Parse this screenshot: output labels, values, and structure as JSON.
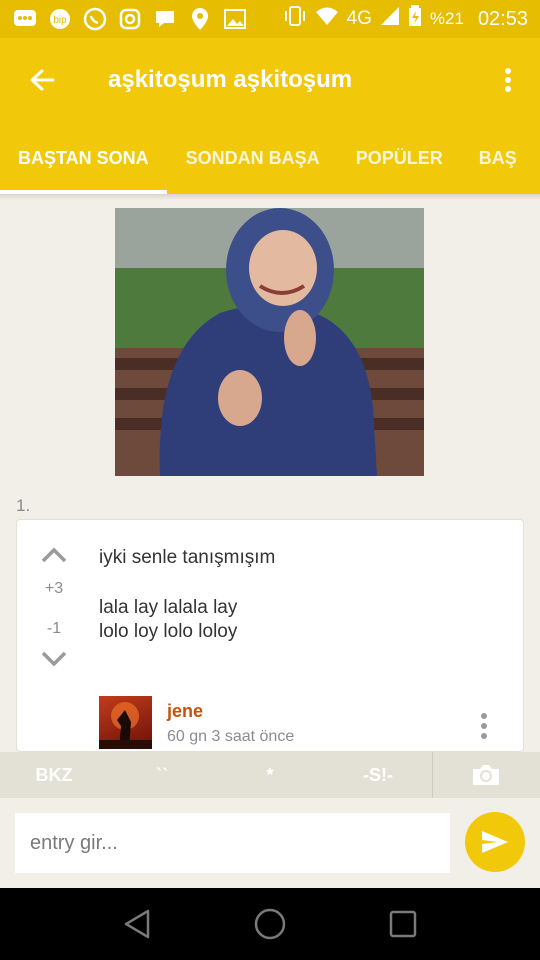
{
  "status_bar": {
    "network": "4G",
    "battery": "%21",
    "time": "02:53",
    "icons": [
      "message-icon",
      "bip-icon",
      "whatsapp-icon",
      "instagram-icon",
      "chat-icon",
      "location-icon",
      "image-icon"
    ]
  },
  "app_bar": {
    "title": "aşkitoşum aşkitoşum"
  },
  "tabs": [
    {
      "label": "BAŞTAN SONA",
      "active": true
    },
    {
      "label": "SONDAN BAŞA",
      "active": false
    },
    {
      "label": "POPÜLER",
      "active": false
    },
    {
      "label": "BAŞ",
      "active": false
    }
  ],
  "entry": {
    "index": "1.",
    "upvotes": "+3",
    "downvotes": "-1",
    "lines": [
      "iyki senle tanışmışım",
      "lala lay lalala lay",
      "lolo loy lolo loloy"
    ],
    "author": "jene",
    "meta": "60 gn 3 saat  önce"
  },
  "format_toolbar": {
    "buttons": [
      "BKZ",
      "``",
      "*",
      "-S!-"
    ]
  },
  "composer": {
    "placeholder": "entry gir..."
  },
  "colors": {
    "primary": "#f2c90a",
    "status_bar": "#e6bd00",
    "author": "#c8520a",
    "background": "#f1efe8"
  }
}
